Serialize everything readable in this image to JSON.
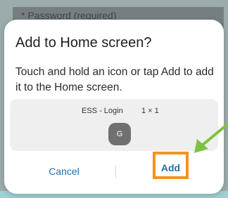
{
  "background": {
    "field_required_marker": "*",
    "field_placeholder": "Password (required)"
  },
  "dialog": {
    "title": "Add to Home screen?",
    "message": "Touch and hold an icon or tap Add to add it to the Home screen.",
    "preview": {
      "app_name": "ESS - Login",
      "size": "1 × 1",
      "icon_letter": "G"
    },
    "buttons": {
      "cancel": "Cancel",
      "add": "Add"
    }
  },
  "colors": {
    "highlight_box": "#f39423",
    "pointer_arrow": "#7fc241",
    "button_text": "#1f6fb0"
  }
}
